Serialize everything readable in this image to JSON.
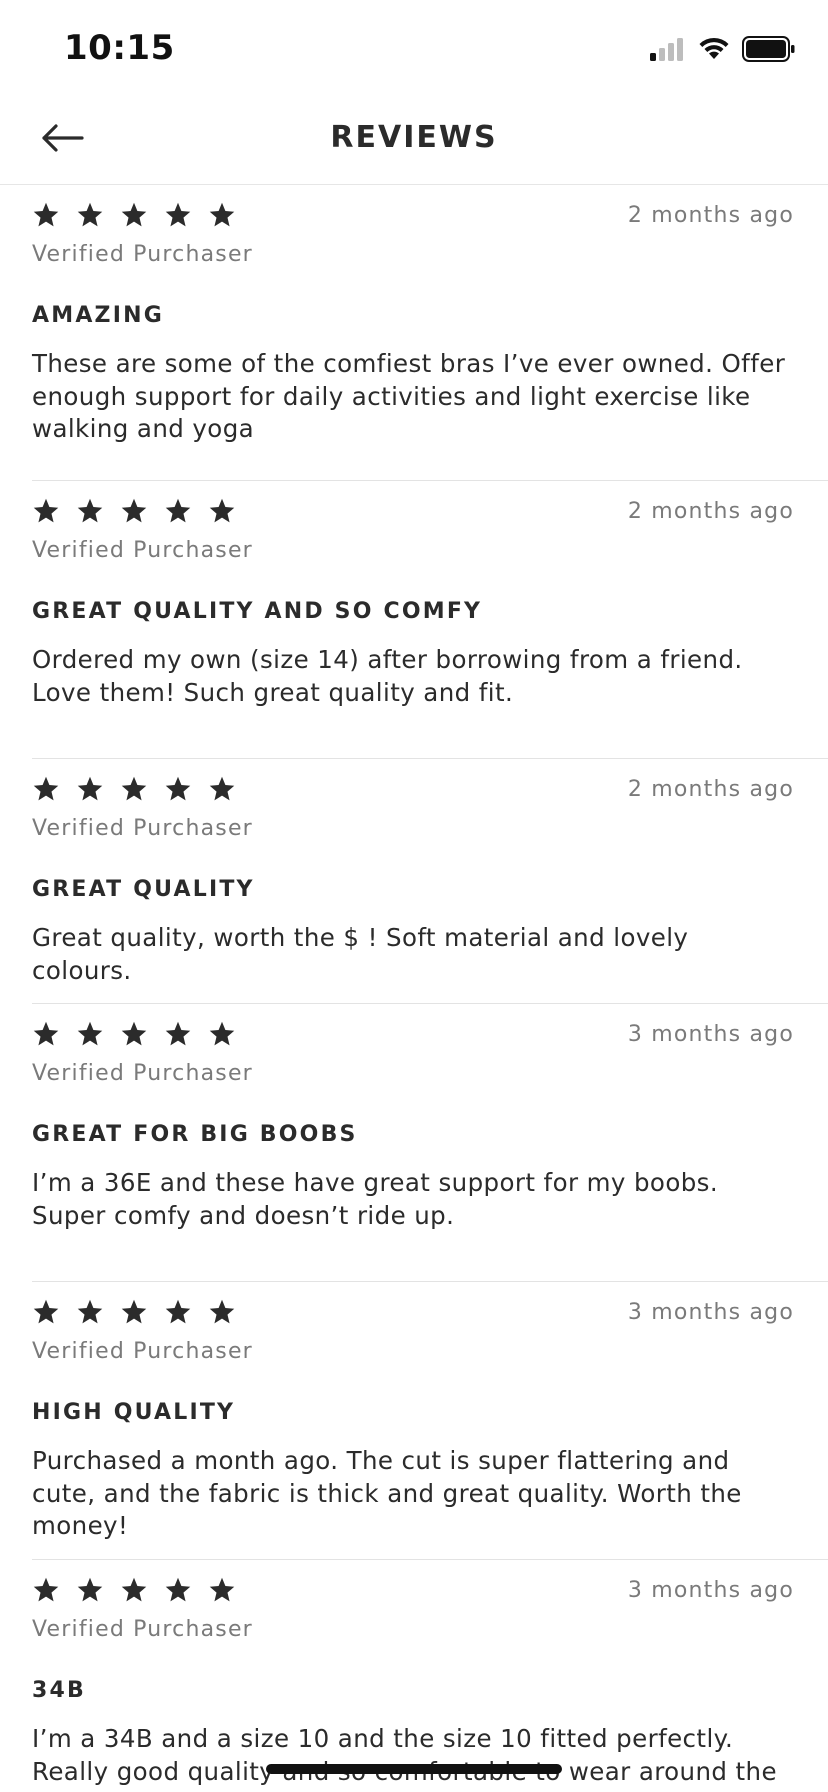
{
  "status_bar": {
    "time": "10:15"
  },
  "header": {
    "title": "REVIEWS",
    "back_icon": "arrow-left-icon"
  },
  "rating_icon": "star-icon",
  "colors": {
    "star": "#2b2b2b",
    "muted_text": "#7a7a7a",
    "divider": "#e3e3e3"
  },
  "reviews": [
    {
      "stars": 5,
      "date": "2 months ago",
      "verified": "Verified Purchaser",
      "title": "AMAZING",
      "body": "These are some of the comfiest bras I’ve ever owned. Offer enough support for daily activities and light exercise like walking and yoga"
    },
    {
      "stars": 5,
      "date": "2 months ago",
      "verified": "Verified Purchaser",
      "title": "GREAT QUALITY AND SO COMFY",
      "body": "Ordered my own (size 14) after borrowing from a friend. Love them! Such great quality and fit."
    },
    {
      "stars": 5,
      "date": "2 months ago",
      "verified": "Verified Purchaser",
      "title": "GREAT QUALITY",
      "body": "Great quality, worth the $ ! Soft material and lovely colours."
    },
    {
      "stars": 5,
      "date": "3 months ago",
      "verified": "Verified Purchaser",
      "title": "GREAT FOR BIG BOOBS",
      "body": "I’m a 36E and these have great support for my boobs. Super comfy and doesn’t ride up."
    },
    {
      "stars": 5,
      "date": "3 months ago",
      "verified": "Verified Purchaser",
      "title": "HIGH QUALITY",
      "body": "Purchased a month ago. The cut is super flattering and cute, and the fabric is thick and great quality. Worth the money!"
    },
    {
      "stars": 5,
      "date": "3 months ago",
      "verified": "Verified Purchaser",
      "title": "34B",
      "body": "I’m a 34B and a size 10 and the size 10 fitted perfectly. Really good quality and so comfortable to wear around the house"
    }
  ]
}
